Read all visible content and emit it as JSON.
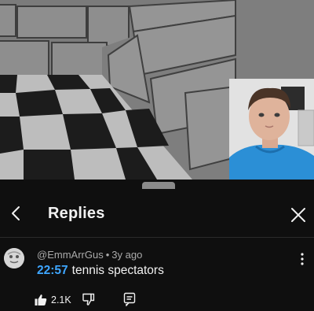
{
  "panel": {
    "title": "Replies",
    "back_icon": "chevron-left-icon",
    "close_icon": "close-icon"
  },
  "comment": {
    "author": "@EmmArrGus",
    "separator": "•",
    "age": "3y ago",
    "timestamp": "22:57",
    "text": "tennis spectators",
    "like_count": "2.1K",
    "icons": {
      "like": "thumbs-up-icon",
      "dislike": "thumbs-down-icon",
      "reply": "reply-icon",
      "more": "more-vertical-icon"
    }
  },
  "colors": {
    "background": "#0f0f0f",
    "text_primary": "#f1f1f1",
    "text_secondary": "#aaaaaa",
    "timestamp_link": "#3ea6ff",
    "presenter_shirt": "#2b8fd6"
  }
}
